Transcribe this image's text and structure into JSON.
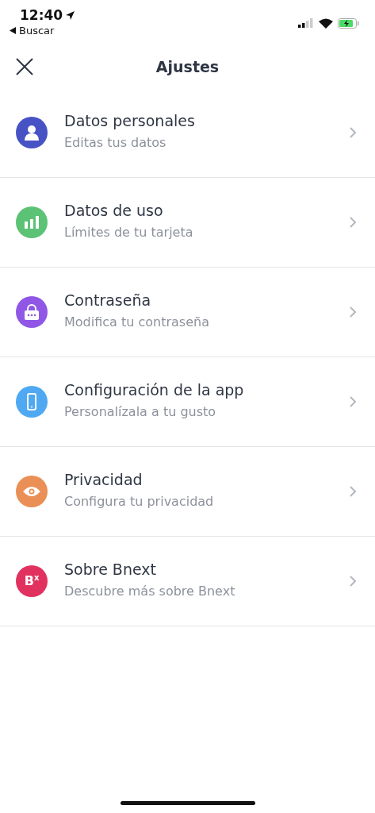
{
  "status_bar": {
    "time": "12:40",
    "back_label": "Buscar"
  },
  "header": {
    "title": "Ajustes"
  },
  "items": [
    {
      "kind": "person",
      "color": "#4753c4",
      "title": "Datos personales",
      "subtitle": "Editas tus datos"
    },
    {
      "kind": "chart",
      "color": "#5cc276",
      "title": "Datos de uso",
      "subtitle": "Límites de tu tarjeta"
    },
    {
      "kind": "lock",
      "color": "#9057e6",
      "title": "Contraseña",
      "subtitle": "Modifica tu contraseña"
    },
    {
      "kind": "phone",
      "color": "#4fa9f2",
      "title": "Configuración de la app",
      "subtitle": "Personalízala a tu gusto"
    },
    {
      "kind": "eye",
      "color": "#ea8f55",
      "title": "Privacidad",
      "subtitle": "Configura tu privacidad"
    },
    {
      "kind": "logo",
      "color": "#e1325f",
      "logo_text": "B$^{x}$",
      "title": "Sobre Bnext",
      "subtitle": "Descubre más sobre Bnext"
    }
  ]
}
